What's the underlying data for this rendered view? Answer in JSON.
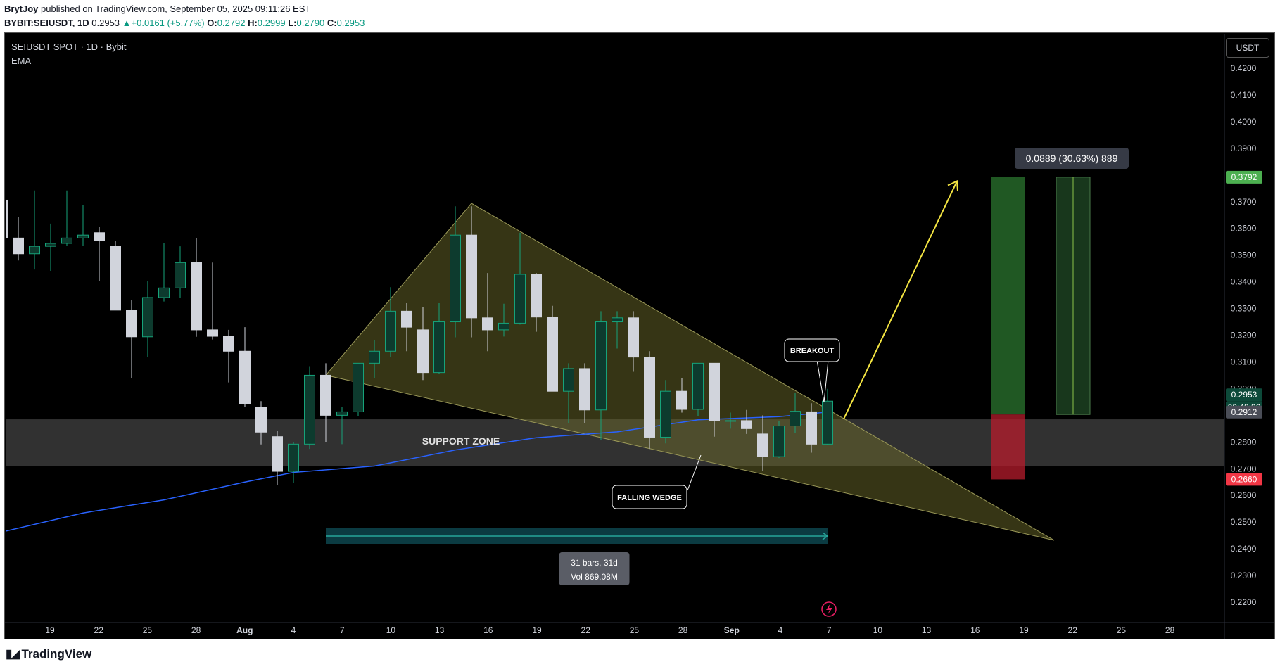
{
  "header": {
    "author": "BrytJoy",
    "published_text": "published on TradingView.com, September 05, 2025 09:11:26 EST",
    "symbol_line": "BYBIT:SEIUSDT, 1D",
    "price": "0.2953",
    "change": "+0.0161 (+5.77%)",
    "o_label": "O:",
    "o_value": "0.2792",
    "h_label": "H:",
    "h_value": "0.2999",
    "l_label": "L:",
    "l_value": "0.2790",
    "c_label": "C:",
    "c_value": "0.2953"
  },
  "legend": {
    "title": "SEIUSDT SPOT · 1D · Bybit",
    "indicator": "EMA"
  },
  "currency_button": "USDT",
  "footer": {
    "brand": "TradingView"
  },
  "colors": {
    "bull_fill": "#0d3b2e",
    "bull_border": "#16a37a",
    "bear_fill": "#d1d4dc",
    "ema": "#2962ff",
    "wedge": "#6b6a2a",
    "support": "#5a5a5a",
    "arrow": "#f5e642",
    "target_green": "#4caf50",
    "stop_red": "#f23645",
    "last_price": "#0d3b2e"
  },
  "chart_data": {
    "type": "candlestick",
    "interval": "1D",
    "y_axis_ticks": [
      "0.4200",
      "0.4100",
      "0.4000",
      "0.3900",
      "0.3800",
      "0.3700",
      "0.3600",
      "0.3500",
      "0.3400",
      "0.3300",
      "0.3200",
      "0.3100",
      "0.3000",
      "0.2800",
      "0.2700",
      "0.2600",
      "0.2500",
      "0.2400",
      "0.2300",
      "0.2200"
    ],
    "x_axis_ticks": [
      "19",
      "22",
      "25",
      "28",
      "Aug",
      "4",
      "7",
      "10",
      "13",
      "16",
      "19",
      "22",
      "25",
      "28",
      "Sep",
      "4",
      "7",
      "10",
      "13",
      "16",
      "19",
      "22",
      "25",
      "28"
    ],
    "price_labels": [
      {
        "text": "0.3792",
        "value": 0.3792,
        "kind": "target"
      },
      {
        "text": "0.2953",
        "value": 0.2953,
        "kind": "last"
      },
      {
        "text": "09:48:36",
        "value": 0.2953,
        "kind": "countdown"
      },
      {
        "text": "0.2912",
        "value": 0.2912,
        "kind": "ema"
      },
      {
        "text": "0.2660",
        "value": 0.266,
        "kind": "stop"
      }
    ],
    "candles": [
      {
        "date": "2025-07-16",
        "o": 0.3706,
        "h": 0.3783,
        "l": 0.3554,
        "c": 0.3564
      },
      {
        "date": "2025-07-17",
        "o": 0.3564,
        "h": 0.3642,
        "l": 0.348,
        "c": 0.3505
      },
      {
        "date": "2025-07-18",
        "o": 0.3505,
        "h": 0.3742,
        "l": 0.3446,
        "c": 0.3533
      },
      {
        "date": "2025-07-19",
        "o": 0.3533,
        "h": 0.3618,
        "l": 0.3441,
        "c": 0.3544
      },
      {
        "date": "2025-07-20",
        "o": 0.3544,
        "h": 0.3742,
        "l": 0.3536,
        "c": 0.3564
      },
      {
        "date": "2025-07-21",
        "o": 0.3564,
        "h": 0.3688,
        "l": 0.3536,
        "c": 0.3575
      },
      {
        "date": "2025-07-22",
        "o": 0.3584,
        "h": 0.3607,
        "l": 0.3404,
        "c": 0.3554
      },
      {
        "date": "2025-07-23",
        "o": 0.3533,
        "h": 0.3554,
        "l": 0.33,
        "c": 0.3294
      },
      {
        "date": "2025-07-24",
        "o": 0.3294,
        "h": 0.3333,
        "l": 0.304,
        "c": 0.3194
      },
      {
        "date": "2025-07-25",
        "o": 0.3194,
        "h": 0.3404,
        "l": 0.3118,
        "c": 0.3341
      },
      {
        "date": "2025-07-26",
        "o": 0.3341,
        "h": 0.3544,
        "l": 0.3326,
        "c": 0.3377
      },
      {
        "date": "2025-07-27",
        "o": 0.3377,
        "h": 0.3533,
        "l": 0.3341,
        "c": 0.3472
      },
      {
        "date": "2025-07-28",
        "o": 0.3472,
        "h": 0.3564,
        "l": 0.3194,
        "c": 0.322
      },
      {
        "date": "2025-07-29",
        "o": 0.322,
        "h": 0.3472,
        "l": 0.3184,
        "c": 0.3196
      },
      {
        "date": "2025-07-30",
        "o": 0.3196,
        "h": 0.322,
        "l": 0.3023,
        "c": 0.314
      },
      {
        "date": "2025-07-31",
        "o": 0.314,
        "h": 0.323,
        "l": 0.293,
        "c": 0.2943
      },
      {
        "date": "2025-08-01",
        "o": 0.293,
        "h": 0.2953,
        "l": 0.2791,
        "c": 0.2837
      },
      {
        "date": "2025-08-02",
        "o": 0.282,
        "h": 0.2843,
        "l": 0.264,
        "c": 0.269
      },
      {
        "date": "2025-08-03",
        "o": 0.269,
        "h": 0.28,
        "l": 0.2648,
        "c": 0.2792
      },
      {
        "date": "2025-08-04",
        "o": 0.2792,
        "h": 0.3084,
        "l": 0.2774,
        "c": 0.305
      },
      {
        "date": "2025-08-05",
        "o": 0.305,
        "h": 0.3095,
        "l": 0.28,
        "c": 0.29
      },
      {
        "date": "2025-08-06",
        "o": 0.29,
        "h": 0.293,
        "l": 0.2792,
        "c": 0.2913
      },
      {
        "date": "2025-08-07",
        "o": 0.2913,
        "h": 0.3095,
        "l": 0.2897,
        "c": 0.3095
      },
      {
        "date": "2025-08-08",
        "o": 0.3095,
        "h": 0.3182,
        "l": 0.304,
        "c": 0.314
      },
      {
        "date": "2025-08-09",
        "o": 0.314,
        "h": 0.338,
        "l": 0.3119,
        "c": 0.329
      },
      {
        "date": "2025-08-10",
        "o": 0.329,
        "h": 0.332,
        "l": 0.314,
        "c": 0.323
      },
      {
        "date": "2025-08-11",
        "o": 0.322,
        "h": 0.3304,
        "l": 0.3032,
        "c": 0.306
      },
      {
        "date": "2025-08-12",
        "o": 0.306,
        "h": 0.332,
        "l": 0.3055,
        "c": 0.325
      },
      {
        "date": "2025-08-13",
        "o": 0.325,
        "h": 0.3683,
        "l": 0.3192,
        "c": 0.3575
      },
      {
        "date": "2025-08-14",
        "o": 0.3575,
        "h": 0.3683,
        "l": 0.3192,
        "c": 0.3265
      },
      {
        "date": "2025-08-15",
        "o": 0.3265,
        "h": 0.3433,
        "l": 0.314,
        "c": 0.322
      },
      {
        "date": "2025-08-16",
        "o": 0.322,
        "h": 0.3318,
        "l": 0.3195,
        "c": 0.3245
      },
      {
        "date": "2025-08-17",
        "o": 0.3245,
        "h": 0.3584,
        "l": 0.324,
        "c": 0.3428
      },
      {
        "date": "2025-08-18",
        "o": 0.3428,
        "h": 0.3433,
        "l": 0.3213,
        "c": 0.3268
      },
      {
        "date": "2025-08-19",
        "o": 0.3268,
        "h": 0.331,
        "l": 0.2997,
        "c": 0.299
      },
      {
        "date": "2025-08-20",
        "o": 0.299,
        "h": 0.3095,
        "l": 0.2872,
        "c": 0.3075
      },
      {
        "date": "2025-08-21",
        "o": 0.3075,
        "h": 0.3095,
        "l": 0.2872,
        "c": 0.292
      },
      {
        "date": "2025-08-22",
        "o": 0.292,
        "h": 0.329,
        "l": 0.2806,
        "c": 0.325
      },
      {
        "date": "2025-08-23",
        "o": 0.325,
        "h": 0.329,
        "l": 0.315,
        "c": 0.3265
      },
      {
        "date": "2025-08-24",
        "o": 0.3265,
        "h": 0.329,
        "l": 0.3063,
        "c": 0.3118
      },
      {
        "date": "2025-08-25",
        "o": 0.3118,
        "h": 0.314,
        "l": 0.2775,
        "c": 0.2818
      },
      {
        "date": "2025-08-26",
        "o": 0.2818,
        "h": 0.3032,
        "l": 0.2795,
        "c": 0.299
      },
      {
        "date": "2025-08-27",
        "o": 0.299,
        "h": 0.304,
        "l": 0.291,
        "c": 0.2922
      },
      {
        "date": "2025-08-28",
        "o": 0.2922,
        "h": 0.3095,
        "l": 0.2898,
        "c": 0.3095
      },
      {
        "date": "2025-08-29",
        "o": 0.3095,
        "h": 0.3095,
        "l": 0.282,
        "c": 0.288
      },
      {
        "date": "2025-08-30",
        "o": 0.288,
        "h": 0.291,
        "l": 0.285,
        "c": 0.288
      },
      {
        "date": "2025-08-31",
        "o": 0.288,
        "h": 0.292,
        "l": 0.283,
        "c": 0.285
      },
      {
        "date": "2025-09-01",
        "o": 0.283,
        "h": 0.29,
        "l": 0.269,
        "c": 0.2745
      },
      {
        "date": "2025-09-02",
        "o": 0.2745,
        "h": 0.288,
        "l": 0.274,
        "c": 0.286
      },
      {
        "date": "2025-09-03",
        "o": 0.286,
        "h": 0.2983,
        "l": 0.2835,
        "c": 0.2915
      },
      {
        "date": "2025-09-04",
        "o": 0.2913,
        "h": 0.2945,
        "l": 0.276,
        "c": 0.2792
      },
      {
        "date": "2025-09-05",
        "o": 0.2792,
        "h": 0.2999,
        "l": 0.279,
        "c": 0.2953
      }
    ],
    "ema": [
      {
        "date": "2025-07-16",
        "v": 0.2463
      },
      {
        "date": "2025-07-21",
        "v": 0.2534
      },
      {
        "date": "2025-07-26",
        "v": 0.2583
      },
      {
        "date": "2025-07-31",
        "v": 0.265
      },
      {
        "date": "2025-08-03",
        "v": 0.2686
      },
      {
        "date": "2025-08-08",
        "v": 0.271
      },
      {
        "date": "2025-08-13",
        "v": 0.277
      },
      {
        "date": "2025-08-18",
        "v": 0.2816
      },
      {
        "date": "2025-08-23",
        "v": 0.2838
      },
      {
        "date": "2025-08-28",
        "v": 0.2883
      },
      {
        "date": "2025-09-02",
        "v": 0.2895
      },
      {
        "date": "2025-09-05",
        "v": 0.2912
      }
    ],
    "drawings": {
      "support_zone": {
        "label": "SUPPORT ZONE",
        "low": 0.271,
        "high": 0.2885
      },
      "falling_wedge": {
        "label": "FALLING WEDGE",
        "points": [
          {
            "date": "2025-08-05",
            "p": 0.305
          },
          {
            "date": "2025-08-14",
            "p": 0.3694
          },
          {
            "date": "2025-09-19",
            "p": 0.2432
          }
        ]
      },
      "breakout_label": "BREAKOUT",
      "date_range": {
        "start": "2025-08-05",
        "end": "2025-09-05",
        "text1": "31 bars, 31d",
        "text2": "Vol 869.08M"
      },
      "target_arrow": {
        "from": {
          "date": "2025-09-06",
          "p": 0.2886
        },
        "to": {
          "date": "2025-09-13",
          "p": 0.3777
        }
      },
      "long_position": {
        "start": "2025-09-15",
        "end": "2025-09-21",
        "entry": 0.2903,
        "target": 0.3792,
        "stop": 0.266,
        "label": "0.0889 (30.63%) 889"
      }
    }
  }
}
